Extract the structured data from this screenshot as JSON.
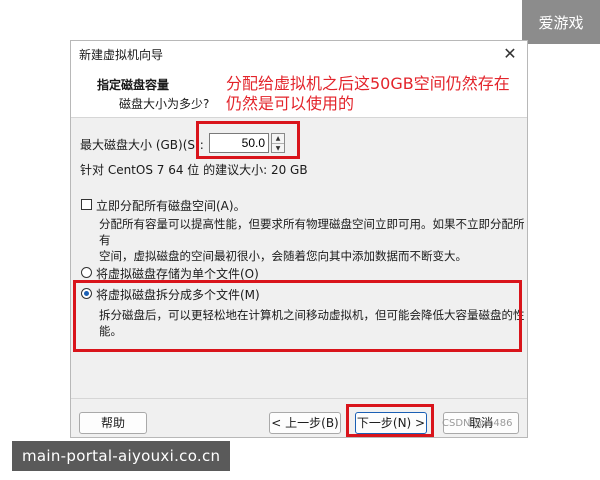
{
  "watermarks": {
    "top_right": "爱游戏",
    "bottom_left": "main-portal-aiyouxi.co.cn",
    "csdn": "CSDN @m486"
  },
  "window": {
    "title": "新建虚拟机向导",
    "close_glyph": "✕"
  },
  "header": {
    "title": "指定磁盘容量",
    "subtitle": "磁盘大小为多少?"
  },
  "annotation": {
    "line1": "分配给虚拟机之后这50GB空间仍然存在",
    "line2": "仍然是可以使用的"
  },
  "disk": {
    "size_label": "最大磁盘大小 (GB)(S):",
    "size_value": "50.0",
    "recommend": "针对 CentOS 7 64 位 的建议大小: 20 GB"
  },
  "allocate_now": {
    "label": "立即分配所有磁盘空间(A)。",
    "checked": false,
    "desc_line1": "分配所有容量可以提高性能，但要求所有物理磁盘空间立即可用。如果不立即分配所有",
    "desc_line2": "空间，虚拟磁盘的空间最初很小，会随着您向其中添加数据而不断变大。"
  },
  "storage_options": [
    {
      "label": "将虚拟磁盘存储为单个文件(O)",
      "selected": false
    },
    {
      "label": "将虚拟磁盘拆分成多个文件(M)",
      "selected": true
    }
  ],
  "split_desc": {
    "line1": "拆分磁盘后，可以更轻松地在计算机之间移动虚拟机，但可能会降低大容量磁盘的性",
    "line2": "能。"
  },
  "buttons": {
    "help": "帮助",
    "back": "< 上一步(B)",
    "next": "下一步(N) >",
    "cancel": "取消"
  },
  "colors": {
    "annotation": "#e3242b",
    "highlight_box": "#d9141b",
    "dialog_bg": "#f0f0f0"
  }
}
